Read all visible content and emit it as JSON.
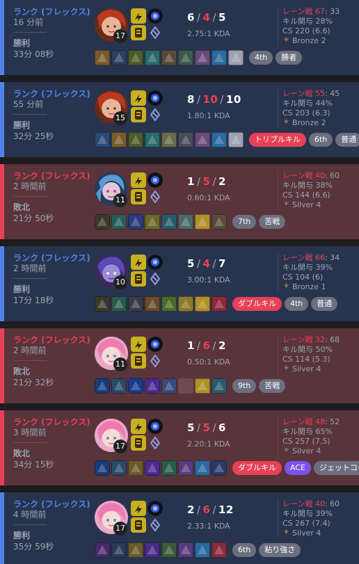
{
  "matches": [
    {
      "result_class": "win",
      "queue": "ランク (フレックス)",
      "time_ago": "16 分前",
      "result": "勝利",
      "duration": "33分 08秒",
      "champion": "champion-portrait-red-hair",
      "level": "17",
      "kda": {
        "k": "6",
        "d": "4",
        "a": "5"
      },
      "kda_ratio": "2.75:1 KDA",
      "pk_label": "レーン戦",
      "pk_value": "67",
      "pk_opp": ": 33",
      "kill_participation": "キル関与 28%",
      "cs": "CS 220 (6.6)",
      "rank": "Bronze 2",
      "items": [
        "#7a5a2a",
        "#2a3f63",
        "#4a5a2a",
        "#2a6a6a",
        "#5a4a3a",
        "#3a5a4a",
        "#6a4a7a",
        "#2a6aa0",
        "#a0a0b0"
      ],
      "tags": [
        {
          "text": "4th",
          "kind": "grey"
        },
        {
          "text": "勝者",
          "kind": "grey"
        }
      ]
    },
    {
      "result_class": "win",
      "queue": "ランク (フレックス)",
      "time_ago": "55 分前",
      "result": "勝利",
      "duration": "32分 25秒",
      "champion": "champion-portrait-red-hair",
      "level": "15",
      "kda": {
        "k": "8",
        "d": "10",
        "a": "10"
      },
      "kda_ratio": "1.80:1 KDA",
      "pk_label": "レーン戦",
      "pk_value": "55",
      "pk_opp": ": 45",
      "kill_participation": "キル関与 44%",
      "cs": "CS 203 (6.3)",
      "rank": "Bronze 2",
      "items": [
        "#2a4a7a",
        "#7a5a2a",
        "#4a5a2a",
        "#2a6a6a",
        "#6a6a4a",
        "#4a4a5a",
        "#6a4a7a",
        "#2a6aa0",
        "#a0a0b0"
      ],
      "tags": [
        {
          "text": "トリプルキル",
          "kind": "multi"
        },
        {
          "text": "6th",
          "kind": "grey"
        },
        {
          "text": "普通",
          "kind": "grey"
        }
      ]
    },
    {
      "result_class": "loss",
      "queue": "ランク (フレックス)",
      "time_ago": "2 時間前",
      "result": "敗北",
      "duration": "21分 50秒",
      "champion": "champion-portrait-blue-hair",
      "level": "11",
      "kda": {
        "k": "1",
        "d": "5",
        "a": "2"
      },
      "kda_ratio": "0.60:1 KDA",
      "pk_label": "レーン戦",
      "pk_value": "40",
      "pk_opp": ": 60",
      "kill_participation": "キル関与 38%",
      "cs": "CS 144 (6.6)",
      "rank": "Silver 4",
      "items": [
        "#3a3a2a",
        "#2a5a5a",
        "#2a3a7a",
        "#6a6a2a",
        "#2a5a6a",
        "#4a6a6a",
        "#b0902a",
        "#5a4a3a"
      ],
      "tags": [
        {
          "text": "7th",
          "kind": "grey"
        },
        {
          "text": "苦戦",
          "kind": "grey"
        }
      ]
    },
    {
      "result_class": "win",
      "queue": "ランク (フレックス)",
      "time_ago": "2 時間前",
      "result": "勝利",
      "duration": "17分 18秒",
      "champion": "champion-portrait-purple",
      "level": "10",
      "kda": {
        "k": "5",
        "d": "4",
        "a": "7"
      },
      "kda_ratio": "3.00:1 KDA",
      "pk_label": "レーン戦",
      "pk_value": "66",
      "pk_opp": ": 34",
      "kill_participation": "キル関与 39%",
      "cs": "CS 104 (6)",
      "rank": "Bronze 1",
      "items": [
        "#3a3a2a",
        "#2a5a4a",
        "#3a3a4a",
        "#6a4a2a",
        "#4a6a2a",
        "#8a7a2a",
        "#b0902a",
        "#8a2a3a"
      ],
      "tags": [
        {
          "text": "ダブルキル",
          "kind": "multi"
        },
        {
          "text": "4th",
          "kind": "grey"
        },
        {
          "text": "普通",
          "kind": "grey"
        }
      ]
    },
    {
      "result_class": "loss",
      "queue": "ランク (フレックス)",
      "time_ago": "2 時間前",
      "result": "敗北",
      "duration": "21分 32秒",
      "champion": "champion-portrait-pink",
      "level": "11",
      "kda": {
        "k": "1",
        "d": "6",
        "a": "2"
      },
      "kda_ratio": "0.50:1 KDA",
      "pk_label": "レーン戦",
      "pk_value": "32",
      "pk_opp": ": 68",
      "kill_participation": "キル関与 50%",
      "cs": "CS 114 (5.3)",
      "rank": "Silver 4",
      "items": [
        "#1a3a7a",
        "#2a4a6a",
        "#1a3a8a",
        "#4a2a8a",
        "#3a4a7a",
        "",
        "#b0902a",
        "#2a5a6a"
      ],
      "tags": [
        {
          "text": "9th",
          "kind": "grey"
        },
        {
          "text": "苦戦",
          "kind": "grey"
        }
      ]
    },
    {
      "result_class": "loss",
      "queue": "ランク (フレックス)",
      "time_ago": "3 時間前",
      "result": "敗北",
      "duration": "34分 15秒",
      "champion": "champion-portrait-pink",
      "level": "17",
      "kda": {
        "k": "5",
        "d": "5",
        "a": "6"
      },
      "kda_ratio": "2.20:1 KDA",
      "pk_label": "レーン戦",
      "pk_value": "48",
      "pk_opp": ": 52",
      "kill_participation": "キル関与 65%",
      "cs": "CS 257 (7.5)",
      "rank": "Silver 4",
      "items": [
        "#1a3a7a",
        "#2a4a6a",
        "#6a5a2a",
        "#4a2a8a",
        "#2a5a4a",
        "#5a3a7a",
        "#2a6aa0",
        "#2a3a6a"
      ],
      "tags": [
        {
          "text": "ダブルキル",
          "kind": "multi"
        },
        {
          "text": "ACE",
          "kind": "ace"
        },
        {
          "text": "ジェットコースター",
          "kind": "grey"
        }
      ]
    },
    {
      "result_class": "win",
      "queue": "ランク (フレックス)",
      "time_ago": "4 時間前",
      "result": "勝利",
      "duration": "35分 59秒",
      "champion": "champion-portrait-pink",
      "level": "17",
      "kda": {
        "k": "2",
        "d": "6",
        "a": "12"
      },
      "kda_ratio": "2.33:1 KDA",
      "pk_label": "レーン戦",
      "pk_value": "40",
      "pk_opp": ": 60",
      "kill_participation": "キル関与 39%",
      "cs": "CS 267 (7.4)",
      "rank": "Silver 4",
      "items": [
        "#4a2a6a",
        "#2a3a5a",
        "#6a5a2a",
        "#4a2a8a",
        "#3a5a3a",
        "#5a3a7a",
        "#2a6aa0",
        "#8a2a3a"
      ],
      "tags": [
        {
          "text": "6th",
          "kind": "grey"
        },
        {
          "text": "粘り強さ",
          "kind": "grey"
        }
      ]
    }
  ],
  "colors": {
    "win": "#5383e8",
    "loss": "#e84057",
    "win_bg": "#28344e",
    "loss_bg": "#59343b"
  },
  "icons": {
    "rank": "rank-emblem-icon",
    "spells": "summoner-spell-icon",
    "runes": "rune-icon"
  }
}
